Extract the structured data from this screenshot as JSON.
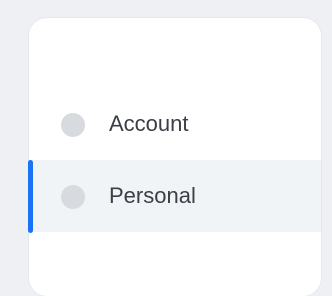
{
  "steps_nav": {
    "items": [
      {
        "label": "Account",
        "state": "inactive",
        "icon": "circle-dot-icon"
      },
      {
        "label": "Personal",
        "state": "active",
        "icon": "circle-dot-icon"
      }
    ],
    "colors": {
      "active_indicator": "#1a73f5",
      "active_background": "#f1f4f7",
      "dot": "#d7dade",
      "text": "#3b3f45"
    }
  }
}
